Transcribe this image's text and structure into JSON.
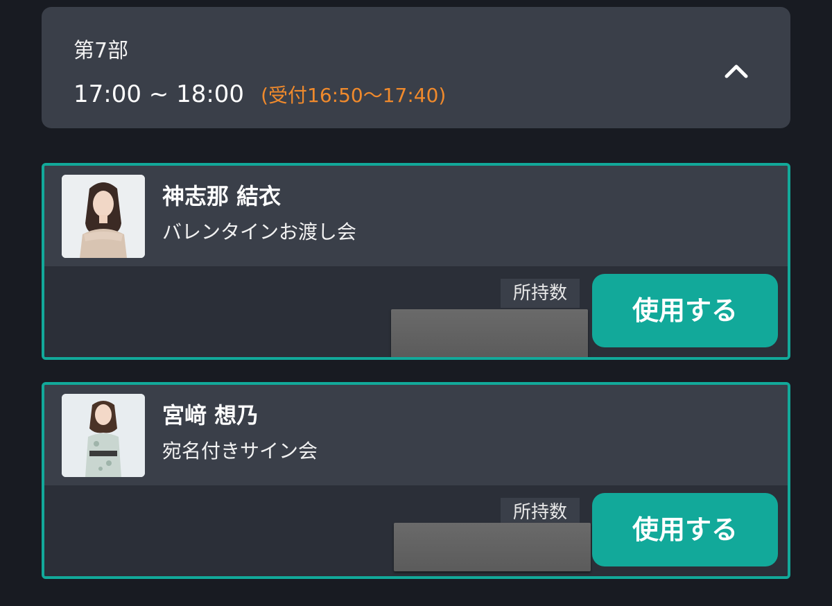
{
  "session": {
    "part_label": "第7部",
    "time": "17:00 ~ 18:00",
    "reception": "(受付16:50〜17:40)",
    "toggle_icon": "chevron-up-icon"
  },
  "tickets": [
    {
      "member_name": "神志那 結衣",
      "event_name": "バレンタインお渡し会",
      "holding_label": "所持数",
      "use_button_label": "使用する"
    },
    {
      "member_name": "宮﨑 想乃",
      "event_name": "宛名付きサイン会",
      "holding_label": "所持数",
      "use_button_label": "使用する"
    }
  ],
  "colors": {
    "accent": "#12a99a",
    "reception_orange": "#f08a2c",
    "card_bg": "#3a3f49",
    "page_bg": "#181b22"
  }
}
